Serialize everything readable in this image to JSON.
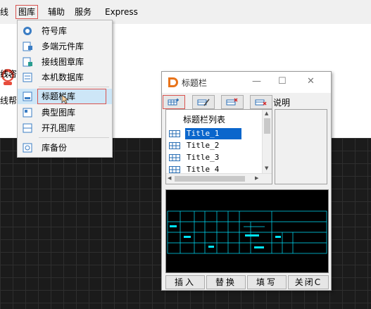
{
  "menubar": {
    "items": [
      {
        "label": "线"
      },
      {
        "label": "图库"
      },
      {
        "label": "辅助"
      },
      {
        "label": "服务"
      },
      {
        "label": "Express"
      }
    ]
  },
  "app": {
    "left_labels": [
      "线咨",
      "线帮"
    ]
  },
  "dropdown": {
    "items": [
      {
        "label": "符号库",
        "icon": "symbol-library-icon"
      },
      {
        "label": "多端元件库",
        "icon": "multi-terminal-icon"
      },
      {
        "label": "接线图章库",
        "icon": "wiring-stamp-icon"
      },
      {
        "label": "本机数据库",
        "icon": "local-database-icon"
      },
      {
        "label": "标题栏库",
        "icon": "title-block-icon"
      },
      {
        "label": "典型图库",
        "icon": "typical-drawing-icon"
      },
      {
        "label": "开孔图库",
        "icon": "cutout-icon"
      },
      {
        "label": "库备份",
        "icon": "backup-icon"
      }
    ]
  },
  "dialog": {
    "title": "标题栏",
    "description_label": "说明",
    "list_header": "标题栏列表",
    "list_items": [
      "Title_1",
      "Title_2",
      "Title_3",
      "Title 4"
    ],
    "selected_index": 0,
    "buttons": {
      "insert": "插入",
      "replace": "替换",
      "fill": "填写",
      "close": "关闭C"
    },
    "accent_color": "#0a66cc",
    "preview_line_color": "#00e5ff"
  }
}
